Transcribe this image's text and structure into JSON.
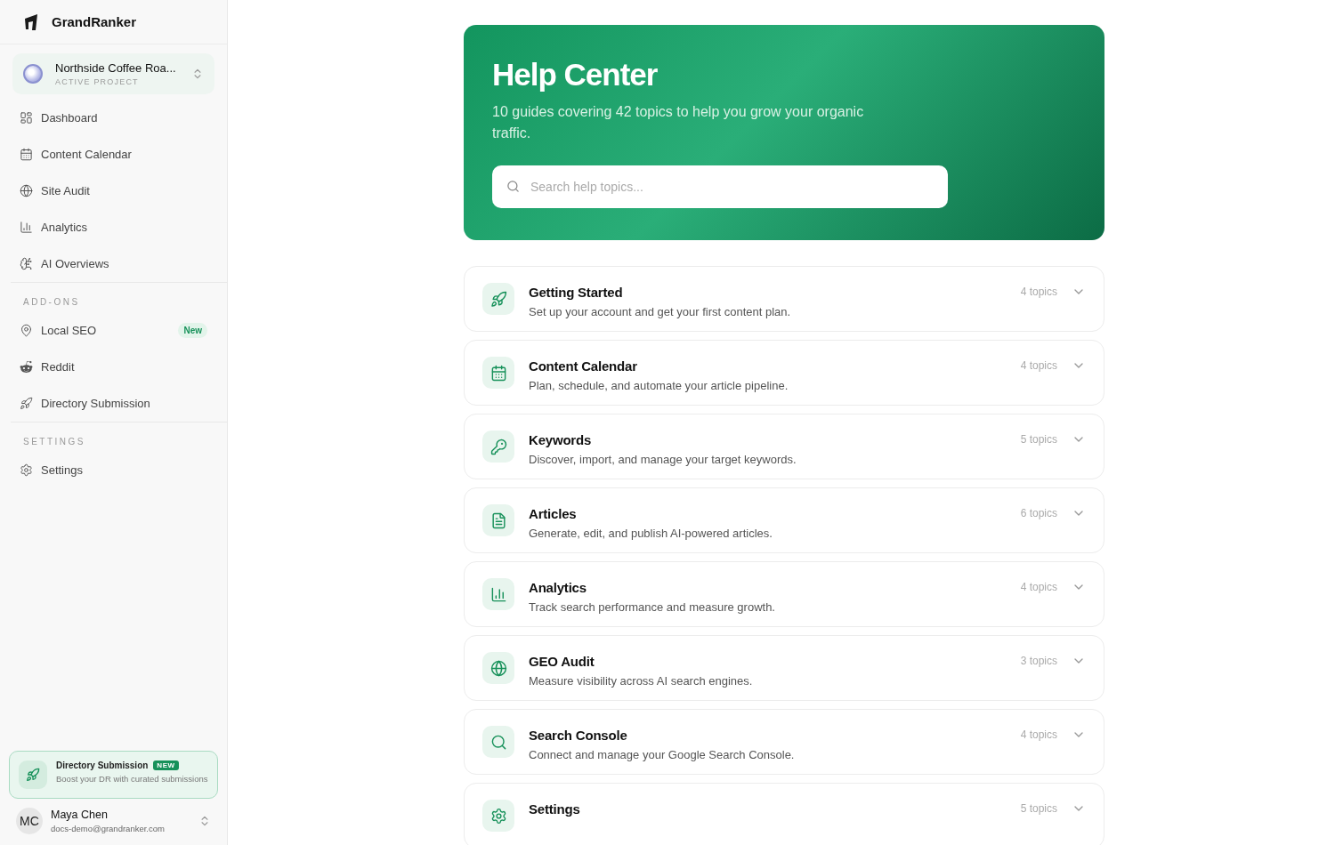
{
  "sidebar": {
    "brand": "GrandRanker",
    "project": {
      "name": "Northside Coffee Roa...",
      "label": "ACTIVE PROJECT"
    },
    "sections": [
      {
        "items": [
          {
            "label": "Dashboard"
          },
          {
            "label": "Content Calendar"
          },
          {
            "label": "Site Audit"
          },
          {
            "label": "Analytics"
          },
          {
            "label": "AI Overviews"
          }
        ]
      },
      {
        "heading": "ADD-ONS",
        "items": [
          {
            "label": "Local SEO",
            "badge": "New"
          },
          {
            "label": "Reddit"
          },
          {
            "label": "Directory Submission"
          }
        ]
      },
      {
        "heading": "SETTINGS",
        "items": [
          {
            "label": "Settings"
          }
        ]
      }
    ],
    "promo": {
      "title": "Directory Submission",
      "badge": "NEW",
      "text": "Boost your DR with curated submissions"
    },
    "user": {
      "initials": "MC",
      "name": "Maya Chen",
      "email": "docs-demo@grandranker.com"
    }
  },
  "hero": {
    "title": "Help Center",
    "subtitle": "10 guides covering 42 topics to help you grow your organic traffic.",
    "search": {
      "placeholder": "Search help topics..."
    }
  },
  "guides": [
    {
      "title": "Getting Started",
      "description": "Set up your account and get your first content plan.",
      "count": "4 topics",
      "expanded": false
    },
    {
      "title": "Content Calendar",
      "description": "Plan, schedule, and automate your article pipeline.",
      "count": "4 topics",
      "expanded": false
    },
    {
      "title": "Keywords",
      "description": "Discover, import, and manage your target keywords.",
      "count": "5 topics",
      "expanded": false
    },
    {
      "title": "Articles",
      "description": "Generate, edit, and publish AI-powered articles.",
      "count": "6 topics",
      "expanded": false
    },
    {
      "title": "Analytics",
      "description": "Track search performance and measure growth.",
      "count": "4 topics",
      "expanded": false
    },
    {
      "title": "GEO Audit",
      "description": "Measure visibility across AI search engines.",
      "count": "3 topics",
      "expanded": false
    },
    {
      "title": "Search Console",
      "description": "Connect and manage your Google Search Console.",
      "count": "4 topics",
      "expanded": false
    },
    {
      "title": "Settings",
      "count": "5 topics",
      "expanded": false
    }
  ]
}
